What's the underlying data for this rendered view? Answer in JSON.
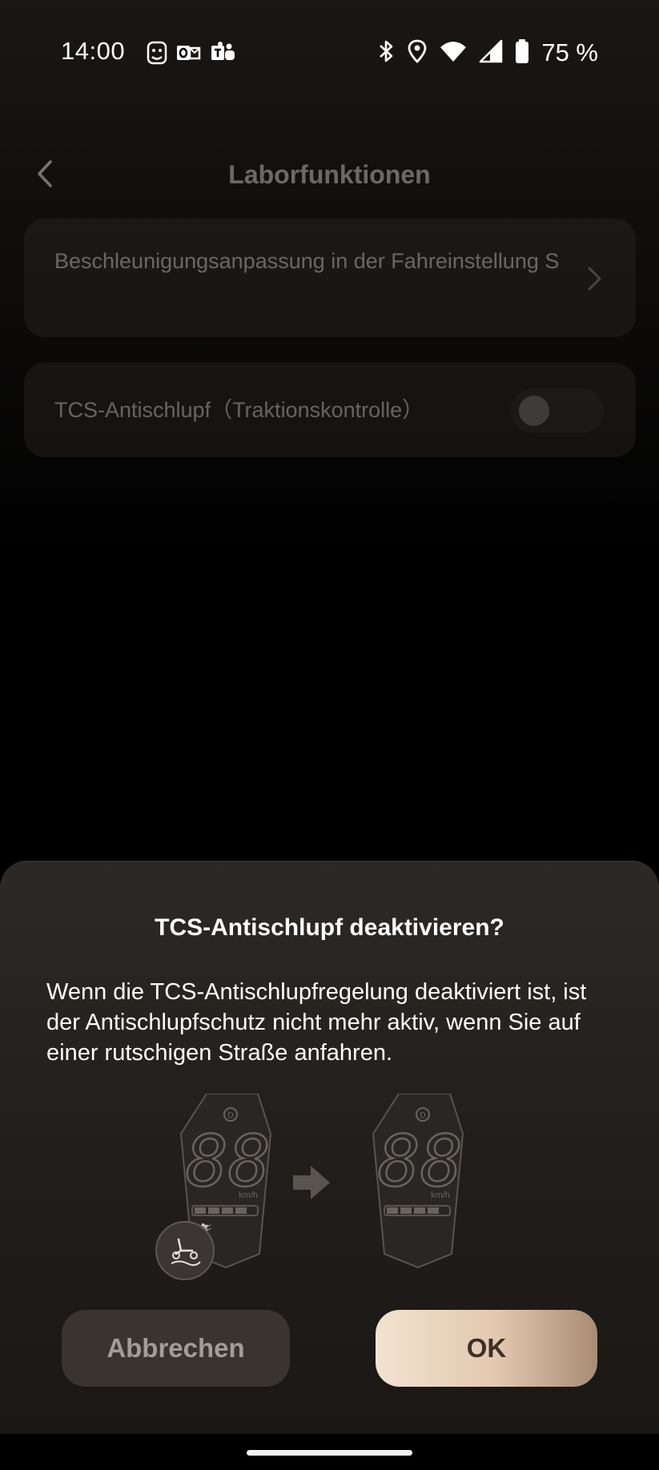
{
  "status_bar": {
    "time": "14:00",
    "battery_percent": "75 %",
    "notification_icons": [
      "lion-app-icon",
      "outlook-icon",
      "teams-icon"
    ],
    "system_icons": [
      "bluetooth-icon",
      "location-icon",
      "wifi-icon",
      "signal-icon",
      "battery-icon"
    ]
  },
  "header": {
    "title": "Laborfunktionen",
    "back_icon": "chevron-left-icon"
  },
  "settings": {
    "items": [
      {
        "label": "Beschleunigungsanpassung in der Fahreinstellung S",
        "control": "chevron-right-icon"
      },
      {
        "label": "TCS-Antischlupf（Traktionskontrolle）",
        "control": "toggle",
        "enabled": false
      }
    ]
  },
  "dialog": {
    "title": "TCS-Antischlupf deaktivieren?",
    "message": "Wenn die TCS-Antischlupfregelung deaktiviert ist, ist der Antischlupfschutz nicht mehr aktiv, wenn Sie auf einer rutschigen Straße anfahren.",
    "illustration": {
      "display_digits": "88",
      "unit": "km/h",
      "mode_badge": "D",
      "before_icon": "tcs-scooter-icon",
      "arrow_icon": "arrow-right-icon"
    },
    "cancel_label": "Abbrechen",
    "ok_label": "OK"
  },
  "colors": {
    "background": "#000000",
    "card": "#2b2622",
    "sheet": "#2d2926",
    "ok_gradient_start": "#f2e3d0",
    "ok_gradient_end": "#a88c74",
    "cancel_bg": "#3a3431"
  }
}
